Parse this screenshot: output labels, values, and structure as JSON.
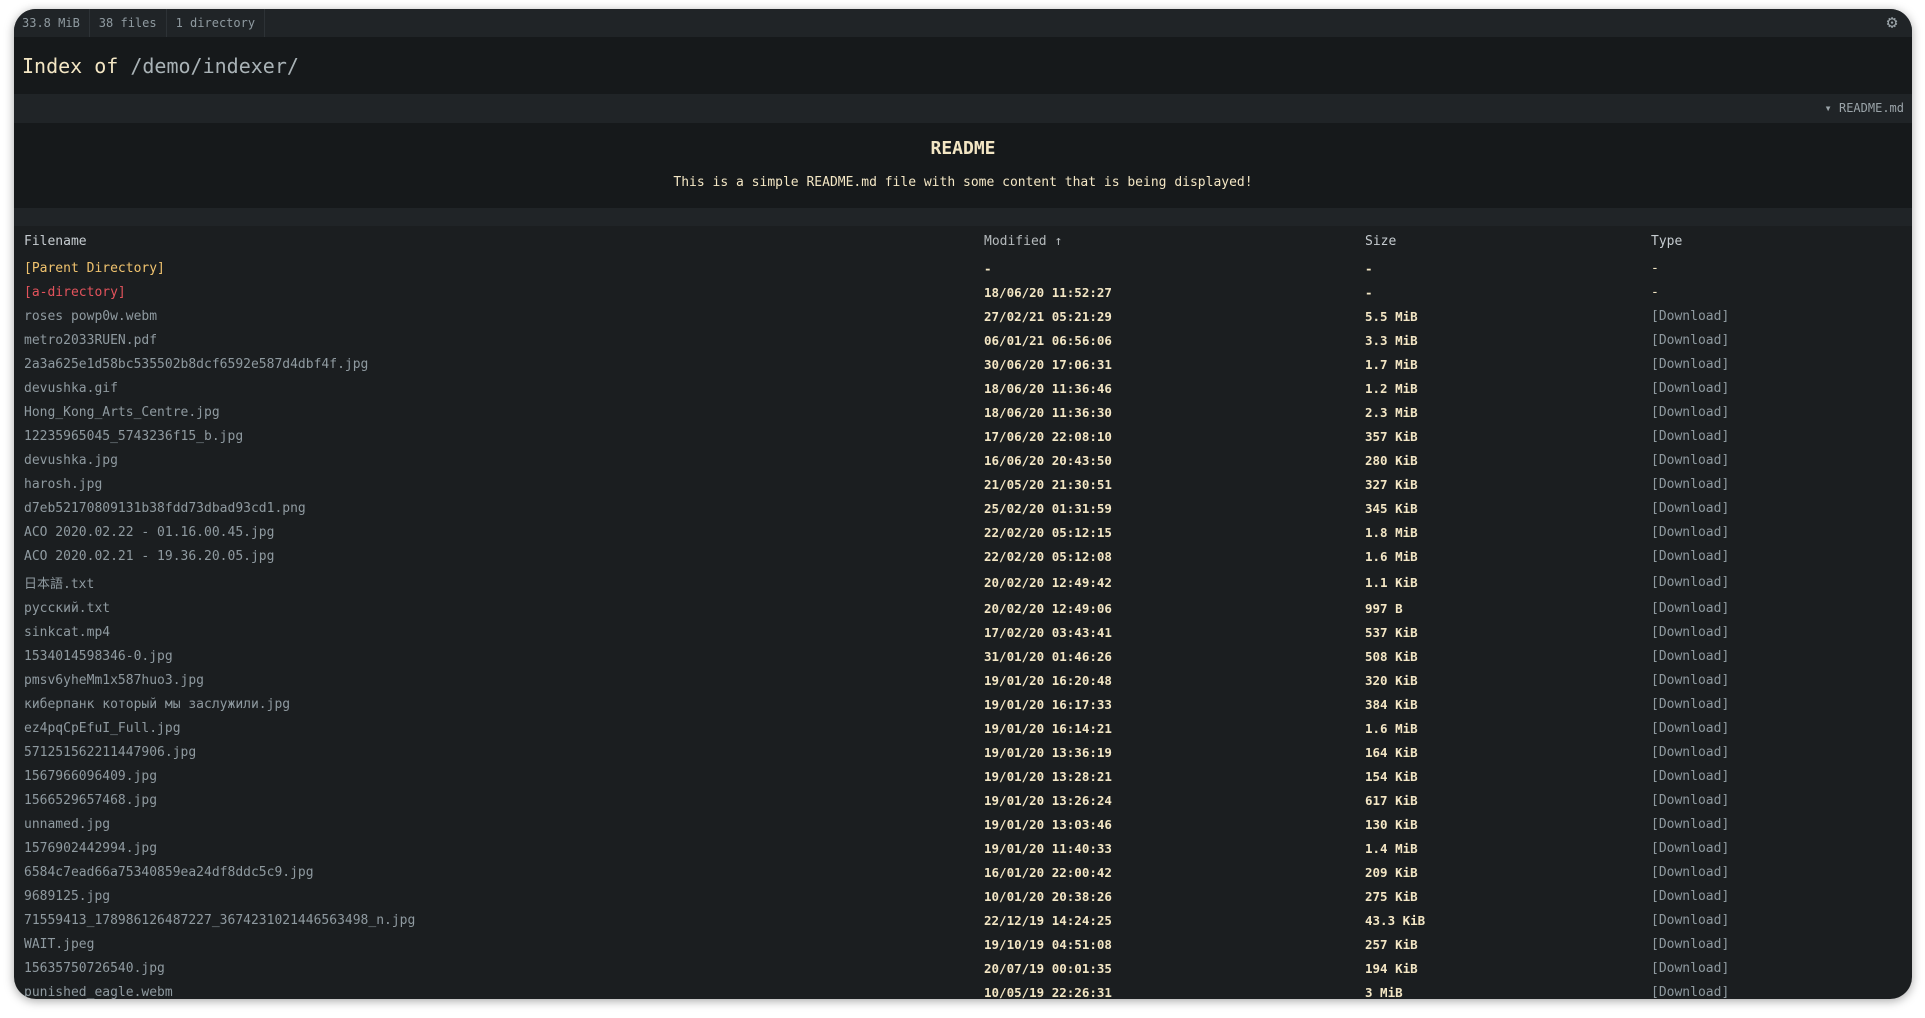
{
  "topbar": {
    "size": "33.8 MiB",
    "files": "38 files",
    "directories": "1 directory",
    "settings_icon": "gear-icon"
  },
  "header": {
    "prefix": "Index of",
    "path": "/demo/indexer/"
  },
  "readme_toggle": {
    "label": "▾ README.md"
  },
  "readme": {
    "title": "README",
    "body": "This is a simple README.md file with some content that is being displayed!"
  },
  "table": {
    "columns": {
      "filename": "Filename",
      "modified": "Modified ↑",
      "size": "Size",
      "type": "Type"
    },
    "rows": [
      {
        "name": "[Parent Directory]",
        "modified": "-",
        "size": "-",
        "type": "-",
        "kind": "parent"
      },
      {
        "name": "[a-directory]",
        "modified": "18/06/20 11:52:27",
        "size": "-",
        "type": "-",
        "kind": "dir"
      },
      {
        "name": "roses powp0w.webm",
        "modified": "27/02/21 05:21:29",
        "size": "5.5 MiB",
        "type": "[Download]",
        "kind": "file"
      },
      {
        "name": "metro2033RUEN.pdf",
        "modified": "06/01/21 06:56:06",
        "size": "3.3 MiB",
        "type": "[Download]",
        "kind": "file"
      },
      {
        "name": "2a3a625e1d58bc535502b8dcf6592e587d4dbf4f.jpg",
        "modified": "30/06/20 17:06:31",
        "size": "1.7 MiB",
        "type": "[Download]",
        "kind": "file"
      },
      {
        "name": "devushka.gif",
        "modified": "18/06/20 11:36:46",
        "size": "1.2 MiB",
        "type": "[Download]",
        "kind": "file"
      },
      {
        "name": "Hong_Kong_Arts_Centre.jpg",
        "modified": "18/06/20 11:36:30",
        "size": "2.3 MiB",
        "type": "[Download]",
        "kind": "file"
      },
      {
        "name": "12235965045_5743236f15_b.jpg",
        "modified": "17/06/20 22:08:10",
        "size": "357 KiB",
        "type": "[Download]",
        "kind": "file"
      },
      {
        "name": "devushka.jpg",
        "modified": "16/06/20 20:43:50",
        "size": "280 KiB",
        "type": "[Download]",
        "kind": "file"
      },
      {
        "name": "harosh.jpg",
        "modified": "21/05/20 21:30:51",
        "size": "327 KiB",
        "type": "[Download]",
        "kind": "file"
      },
      {
        "name": "d7eb52170809131b38fdd73dbad93cd1.png",
        "modified": "25/02/20 01:31:59",
        "size": "345 KiB",
        "type": "[Download]",
        "kind": "file"
      },
      {
        "name": "ACO 2020.02.22 - 01.16.00.45.jpg",
        "modified": "22/02/20 05:12:15",
        "size": "1.8 MiB",
        "type": "[Download]",
        "kind": "file"
      },
      {
        "name": "ACO 2020.02.21 - 19.36.20.05.jpg",
        "modified": "22/02/20 05:12:08",
        "size": "1.6 MiB",
        "type": "[Download]",
        "kind": "file"
      },
      {
        "name": "日本語.txt",
        "modified": "20/02/20 12:49:42",
        "size": "1.1 KiB",
        "type": "[Download]",
        "kind": "file",
        "tall": true
      },
      {
        "name": "русский.txt",
        "modified": "20/02/20 12:49:06",
        "size": "997 B",
        "type": "[Download]",
        "kind": "file"
      },
      {
        "name": "sinkcat.mp4",
        "modified": "17/02/20 03:43:41",
        "size": "537 KiB",
        "type": "[Download]",
        "kind": "file"
      },
      {
        "name": "1534014598346-0.jpg",
        "modified": "31/01/20 01:46:26",
        "size": "508 KiB",
        "type": "[Download]",
        "kind": "file"
      },
      {
        "name": "pmsv6yheMm1x587huo3.jpg",
        "modified": "19/01/20 16:20:48",
        "size": "320 KiB",
        "type": "[Download]",
        "kind": "file"
      },
      {
        "name": "киберпанк который мы заслужили.jpg",
        "modified": "19/01/20 16:17:33",
        "size": "384 KiB",
        "type": "[Download]",
        "kind": "file"
      },
      {
        "name": "ez4pqCpEfuI_Full.jpg",
        "modified": "19/01/20 16:14:21",
        "size": "1.6 MiB",
        "type": "[Download]",
        "kind": "file"
      },
      {
        "name": "571251562211447906.jpg",
        "modified": "19/01/20 13:36:19",
        "size": "164 KiB",
        "type": "[Download]",
        "kind": "file"
      },
      {
        "name": "1567966096409.jpg",
        "modified": "19/01/20 13:28:21",
        "size": "154 KiB",
        "type": "[Download]",
        "kind": "file"
      },
      {
        "name": "1566529657468.jpg",
        "modified": "19/01/20 13:26:24",
        "size": "617 KiB",
        "type": "[Download]",
        "kind": "file"
      },
      {
        "name": "unnamed.jpg",
        "modified": "19/01/20 13:03:46",
        "size": "130 KiB",
        "type": "[Download]",
        "kind": "file"
      },
      {
        "name": "1576902442994.jpg",
        "modified": "19/01/20 11:40:33",
        "size": "1.4 MiB",
        "type": "[Download]",
        "kind": "file"
      },
      {
        "name": "6584c7ead66a75340859ea24df8ddc5c9.jpg",
        "modified": "16/01/20 22:00:42",
        "size": "209 KiB",
        "type": "[Download]",
        "kind": "file"
      },
      {
        "name": "9689125.jpg",
        "modified": "10/01/20 20:38:26",
        "size": "275 KiB",
        "type": "[Download]",
        "kind": "file"
      },
      {
        "name": "71559413_178986126487227_3674231021446563498_n.jpg",
        "modified": "22/12/19 14:24:25",
        "size": "43.3 KiB",
        "type": "[Download]",
        "kind": "file"
      },
      {
        "name": "WAIT.jpeg",
        "modified": "19/10/19 04:51:08",
        "size": "257 KiB",
        "type": "[Download]",
        "kind": "file"
      },
      {
        "name": "15635750726540.jpg",
        "modified": "20/07/19 00:01:35",
        "size": "194 KiB",
        "type": "[Download]",
        "kind": "file"
      },
      {
        "name": "punished_eagle.webm",
        "modified": "10/05/19 22:26:31",
        "size": "3 MiB",
        "type": "[Download]",
        "kind": "file"
      }
    ]
  }
}
